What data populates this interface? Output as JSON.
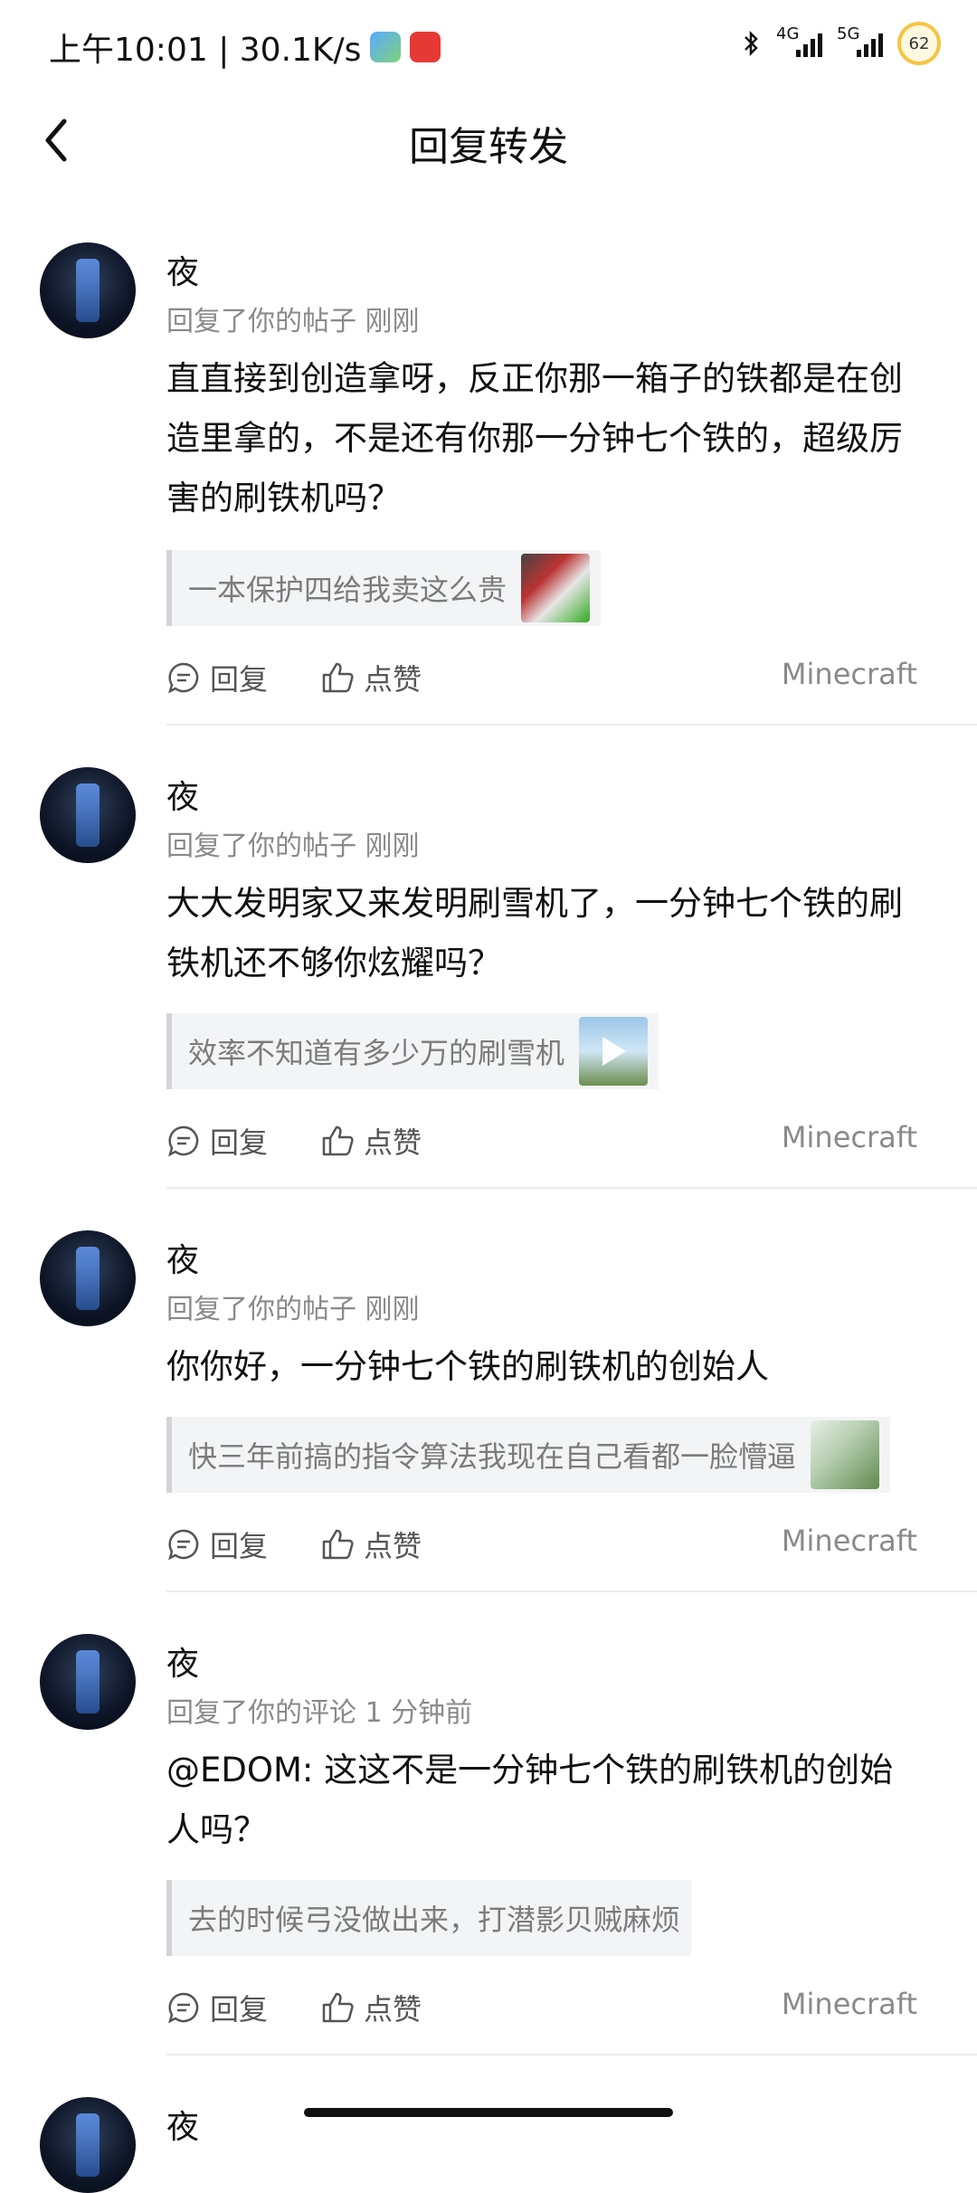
{
  "status_bar": {
    "time_speed": "上午10:01 | 30.1K/s",
    "net1": "4G",
    "net2": "5G",
    "battery": "62"
  },
  "header": {
    "title": "回复转发"
  },
  "labels": {
    "reply": "回复",
    "like": "点赞"
  },
  "items": [
    {
      "name": "夜",
      "meta": "回复了你的帖子  刚刚",
      "content": "直直接到创造拿呀，反正你那一箱子的铁都是在创造里拿的，不是还有你那一分钟七个铁的，超级厉害的刷铁机吗？",
      "quote": "一本保护四给我卖这么贵",
      "tag": "Minecraft"
    },
    {
      "name": "夜",
      "meta": "回复了你的帖子  刚刚",
      "content": "大大发明家又来发明刷雪机了，一分钟七个铁的刷铁机还不够你炫耀吗？",
      "quote": "效率不知道有多少万的刷雪机",
      "tag": "Minecraft"
    },
    {
      "name": "夜",
      "meta": "回复了你的帖子  刚刚",
      "content": "你你好，一分钟七个铁的刷铁机的创始人",
      "quote": "快三年前搞的指令算法我现在自己看都一脸懵逼",
      "tag": "Minecraft"
    },
    {
      "name": "夜",
      "meta": "回复了你的评论  1 分钟前",
      "content": "@EDOM: 这这不是一分钟七个铁的刷铁机的创始人吗？",
      "quote": "去的时候弓没做出来，打潜影贝贼麻烦",
      "tag": "Minecraft"
    },
    {
      "name": "夜"
    }
  ]
}
